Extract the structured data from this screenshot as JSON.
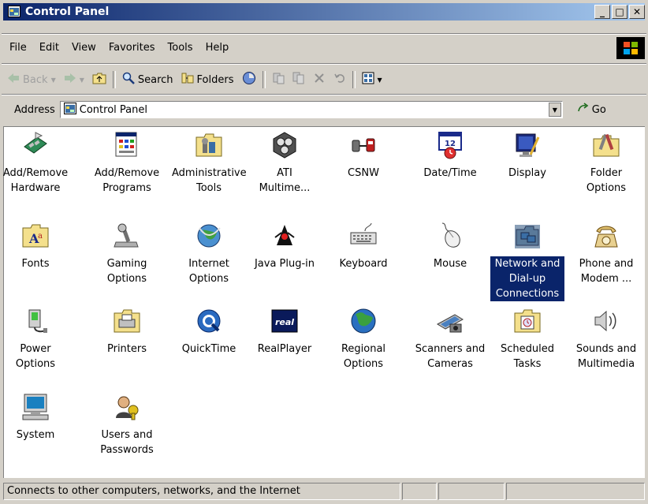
{
  "window": {
    "title": "Control Panel",
    "controls": {
      "minimize": "_",
      "maximize": "□",
      "close": "✕"
    }
  },
  "menubar": [
    "File",
    "Edit",
    "View",
    "Favorites",
    "Tools",
    "Help"
  ],
  "toolbar": {
    "back": "Back",
    "search": "Search",
    "folders": "Folders"
  },
  "address": {
    "label": "Address",
    "value": "Control Panel",
    "go": "Go"
  },
  "items": [
    {
      "label": "Add/Remove\nHardware",
      "icon": "hardware-icon"
    },
    {
      "label": "Add/Remove\nPrograms",
      "icon": "programs-icon"
    },
    {
      "label": "Administrative\nTools",
      "icon": "admin-tools-icon"
    },
    {
      "label": "ATI\nMultime...",
      "icon": "ati-icon"
    },
    {
      "label": "CSNW",
      "icon": "csnw-icon"
    },
    {
      "label": "Date/Time",
      "icon": "calendar-clock-icon"
    },
    {
      "label": "Display",
      "icon": "display-icon"
    },
    {
      "label": "Folder\nOptions",
      "icon": "folder-options-icon"
    },
    {
      "label": "Fonts",
      "icon": "fonts-icon"
    },
    {
      "label": "Gaming\nOptions",
      "icon": "joystick-icon"
    },
    {
      "label": "Internet\nOptions",
      "icon": "globe-icon"
    },
    {
      "label": "Java Plug-in",
      "icon": "java-icon"
    },
    {
      "label": "Keyboard",
      "icon": "keyboard-icon"
    },
    {
      "label": "Mouse",
      "icon": "mouse-icon"
    },
    {
      "label": "Network and\nDial-up\nConnections",
      "icon": "network-icon",
      "selected": true
    },
    {
      "label": "Phone and\nModem ...",
      "icon": "phone-icon"
    },
    {
      "label": "Power\nOptions",
      "icon": "power-icon"
    },
    {
      "label": "Printers",
      "icon": "printer-icon"
    },
    {
      "label": "QuickTime",
      "icon": "quicktime-icon"
    },
    {
      "label": "RealPlayer",
      "icon": "realplayer-icon",
      "icon_text": "real"
    },
    {
      "label": "Regional\nOptions",
      "icon": "globe-icon"
    },
    {
      "label": "Scanners and\nCameras",
      "icon": "scanner-icon"
    },
    {
      "label": "Scheduled\nTasks",
      "icon": "scheduled-tasks-icon"
    },
    {
      "label": "Sounds and\nMultimedia",
      "icon": "speaker-icon"
    },
    {
      "label": "System",
      "icon": "computer-icon"
    },
    {
      "label": "Users and\nPasswords",
      "icon": "users-icon"
    }
  ],
  "status": {
    "text": "Connects to other computers, networks, and the Internet"
  },
  "colors": {
    "titlebar_start": "#0a246a",
    "titlebar_end": "#a6caf0",
    "selection": "#0a246a",
    "chrome": "#d4d0c8"
  }
}
